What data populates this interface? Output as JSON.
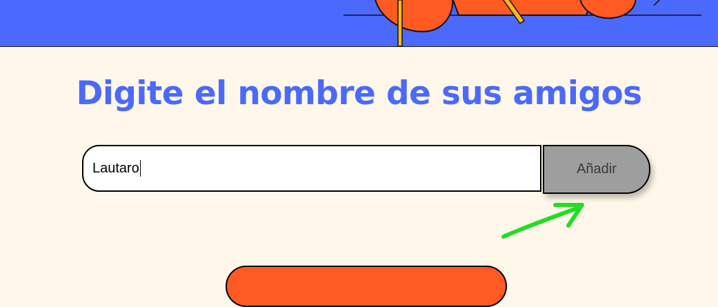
{
  "header": {
    "illustration_icon": "decorative-people-illustration-icon"
  },
  "main": {
    "title": "Digite el nombre de sus amigos",
    "friend_input": {
      "value": "Lautaro",
      "placeholder": ""
    },
    "add_button_label": "Añadir",
    "annotation_icon": "green-arrow-icon"
  },
  "colors": {
    "accent_blue": "#4B69FD",
    "background": "#FFF8EA",
    "orange": "#FF5A22",
    "button_gray": "#9E9E9E",
    "annotation_green": "#22DD22"
  }
}
